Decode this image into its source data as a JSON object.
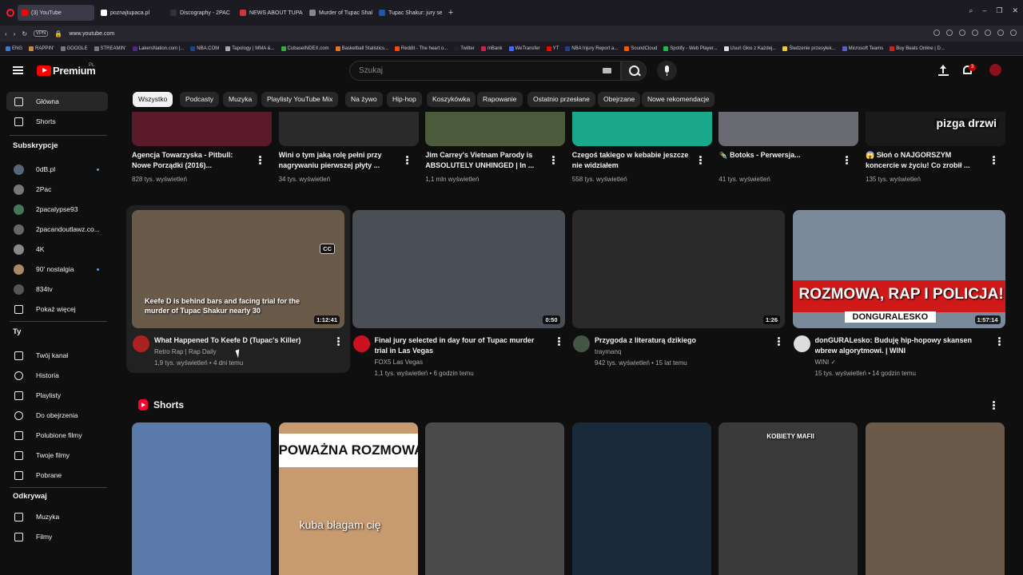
{
  "browser": {
    "tabs": [
      {
        "label": "(3) YouTube",
        "active": true,
        "color": "#ff0000"
      },
      {
        "label": "poznajtupaca.pl",
        "active": false,
        "color": "#ffffff"
      },
      {
        "label": "Discography - 2PAC",
        "active": false,
        "color": "#333333"
      },
      {
        "label": "NEWS ABOUT TUPAC'S TH",
        "active": false,
        "color": "#cc3344"
      },
      {
        "label": "Murder of Tupac Shakur",
        "active": false,
        "color": "#888888"
      },
      {
        "label": "Tupac Shakur: jury selecti",
        "active": false,
        "color": "#2255aa"
      }
    ],
    "url": "www.youtube.com",
    "vpn": "VPN",
    "bookmarks": [
      {
        "label": "ENG",
        "color": "#4477cc"
      },
      {
        "label": "RAPPIN'",
        "color": "#cc8844"
      },
      {
        "label": "GOOGLE",
        "color": "#777777"
      },
      {
        "label": "STREAMIN'",
        "color": "#777777"
      },
      {
        "label": "LakersNation.com |...",
        "color": "#552288"
      },
      {
        "label": "NBA.COM",
        "color": "#1d428a"
      },
      {
        "label": "Tapology | MMA &...",
        "color": "#aaaaaa"
      },
      {
        "label": "CubaseINDEX.com",
        "color": "#33aa44"
      },
      {
        "label": "Basketball Statistics...",
        "color": "#dd7722"
      },
      {
        "label": "Reddit - The heart o...",
        "color": "#ff4500"
      },
      {
        "label": "Twitter",
        "color": "#222222"
      },
      {
        "label": "mBank",
        "color": "#cc2244"
      },
      {
        "label": "WeTransfer",
        "color": "#4466ff"
      },
      {
        "label": "YT",
        "color": "#ff0000"
      },
      {
        "label": "NBA Injury Report a...",
        "color": "#1d428a"
      },
      {
        "label": "SoundCloud",
        "color": "#ff5500"
      },
      {
        "label": "Spotify - Web Player...",
        "color": "#1db954"
      },
      {
        "label": "Usuń Głos z Każdej...",
        "color": "#dddddd"
      },
      {
        "label": "Śledzenie przesyłek...",
        "color": "#eecc33"
      },
      {
        "label": "Microsoft Teams",
        "color": "#5b5fc7"
      },
      {
        "label": "Buy Beats Online | D...",
        "color": "#cc2222"
      }
    ]
  },
  "masthead": {
    "logo_text": "Premium",
    "logo_country": "PL",
    "search_placeholder": "Szukaj",
    "notifications_count": "3"
  },
  "sidebar": {
    "main": [
      {
        "label": "Główna",
        "icon": "home-icon",
        "active": true
      },
      {
        "label": "Shorts",
        "icon": "shorts-icon",
        "active": false
      }
    ],
    "subscriptions_heading": "Subskrypcje",
    "subscriptions": [
      {
        "label": "0dB.pl",
        "color": "#556677",
        "dot": true
      },
      {
        "label": "2Pac",
        "color": "#777777",
        "dot": false
      },
      {
        "label": "2pacalypse93",
        "color": "#447755",
        "dot": false
      },
      {
        "label": "2pacandoutlawz.co...",
        "color": "#666666",
        "dot": false
      },
      {
        "label": "4K",
        "color": "#888888",
        "dot": false
      },
      {
        "label": "90' nostalgia",
        "color": "#aa8866",
        "dot": true
      },
      {
        "label": "834tv",
        "color": "#555555",
        "dot": false
      }
    ],
    "show_more": "Pokaż więcej",
    "you_heading": "Ty",
    "you_items": [
      {
        "label": "Twój kanał",
        "icon": "channel-icon"
      },
      {
        "label": "Historia",
        "icon": "history-icon"
      },
      {
        "label": "Playlisty",
        "icon": "playlists-icon"
      },
      {
        "label": "Do obejrzenia",
        "icon": "watch-later-icon"
      },
      {
        "label": "Polubione filmy",
        "icon": "liked-icon"
      },
      {
        "label": "Twoje filmy",
        "icon": "your-videos-icon"
      },
      {
        "label": "Pobrane",
        "icon": "download-icon"
      }
    ],
    "explore_heading": "Odkrywaj",
    "explore_items": [
      {
        "label": "Muzyka",
        "icon": "music-icon"
      },
      {
        "label": "Filmy",
        "icon": "movies-icon"
      }
    ]
  },
  "chips": [
    "Wszystko",
    "Podcasty",
    "Muzyka",
    "Playlisty YouTube Mix",
    "Na żywo",
    "Hip-hop",
    "Koszykówka",
    "Rapowanie",
    "Ostatnio przesłane",
    "Obejrzane",
    "Nowe rekomendacje"
  ],
  "row1": [
    {
      "title": "Agencja Towarzyska - Pitbull: Nowe Porządki (2016)...",
      "meta": "828 tys. wyświetleń",
      "thumb": "#5a1a2a",
      "overlay": ""
    },
    {
      "title": "Wini o tym jaką rolę pełni przy nagrywaniu pierwszej płyty ...",
      "meta": "34 tys. wyświetleń",
      "thumb": "#2a2a2a",
      "overlay": ""
    },
    {
      "title": "Jim Carrey's Vietnam Parody is ABSOLUTELY UNHINGED | In ...",
      "meta": "1,1 mln wyświetleń",
      "thumb": "#4a5a3a",
      "overlay": ""
    },
    {
      "title": "Czegoś takiego w kebabie jeszcze nie widziałem",
      "meta": "558 tys. wyświetleń",
      "thumb": "#1aa88a",
      "overlay": ""
    },
    {
      "title": "✒️ Botoks - Perwersja...",
      "meta": "41 tys. wyświetleń",
      "thumb": "#6a6a72",
      "overlay": ""
    },
    {
      "title": "😱 Słoń o NAJGORSZYM koncercie w życiu! Co zrobił ...",
      "meta": "135 tys. wyświetleń",
      "thumb": "#1a1a1a",
      "overlay": "pizga drzwi"
    }
  ],
  "row2": [
    {
      "title": "What Happened To Keefe D (Tupac's Killer)",
      "channel": "Retro Rap | Rap Daily",
      "meta": "1,9 tys. wyświetleń • 4 dni temu",
      "duration": "1:12:41",
      "overlay": "Keefe D is behind bars and facing trial for the murder of Tupac Shakur nearly 30",
      "thumb": "#6a5a4a",
      "avatar": "#aa2222",
      "cc": "CC",
      "verified": false
    },
    {
      "title": "Final jury selected in day four of Tupac murder trial in Las Vegas",
      "channel": "FOX5 Las Vegas",
      "meta": "1,1 tys. wyświetleń • 6 godzin temu",
      "duration": "0:50",
      "overlay": "",
      "thumb": "#4a4e56",
      "avatar": "#cc1122",
      "cc": "",
      "verified": false
    },
    {
      "title": "Przygoda z literaturą dzikiego",
      "channel": "traymanq",
      "meta": "942 tys. wyświetleń • 15 lat temu",
      "duration": "1:26",
      "overlay": "",
      "thumb": "#2a2a2a",
      "avatar": "#445544",
      "cc": "",
      "verified": false
    },
    {
      "title": "donGURALesko: Buduję hip-hopowy skansen wbrew algorytmowi. | WINI",
      "channel": "WINI",
      "meta": "15 tys. wyświetleń • 14 godzin temu",
      "duration": "1:57:14",
      "overlay": "ROZMOWA, RAP I POLICJA!",
      "overlay2": "DONGURALESKO",
      "thumb": "#7a8a9a",
      "avatar": "#dddddd",
      "cc": "",
      "verified": true
    }
  ],
  "shorts": {
    "heading": "Shorts",
    "items": [
      {
        "thumb": "#5a7aaa",
        "text": ""
      },
      {
        "thumb": "#c89a70",
        "text": "kuba błagam cię",
        "top_text": "POWAŻNA ROZMOWA"
      },
      {
        "thumb": "#4a4a4a",
        "text": ""
      },
      {
        "thumb": "#1a2a3a",
        "text": ""
      },
      {
        "thumb": "#3a3a3a",
        "text": "",
        "top_text": "KOBIETY MAFII"
      },
      {
        "thumb": "#6a5a4a",
        "text": ""
      }
    ]
  }
}
